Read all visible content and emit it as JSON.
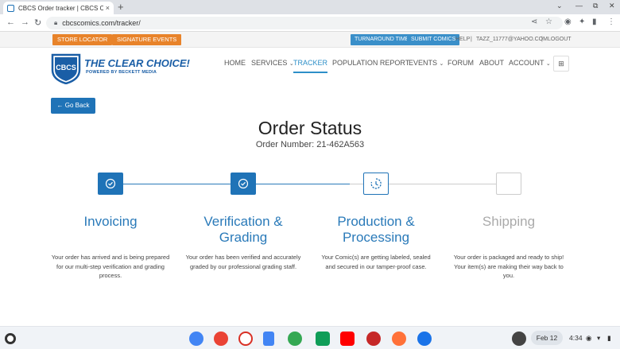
{
  "browser": {
    "tab_title": "CBCS Order tracker | CBCS Comi",
    "tab_close": "×",
    "new_tab": "+",
    "url": "cbcscomics.com/tracker/",
    "back": "←",
    "forward": "→",
    "reload": "↻",
    "minimize": "—",
    "restore": "⧉",
    "close": "✕",
    "dropdown": "⌄"
  },
  "utility": {
    "store_locator": "STORE LOCATOR",
    "signature_events": "SIGNATURE EVENTS",
    "turnaround_times": "TURNAROUND TIMES",
    "submit_comics": "SUBMIT COMICS",
    "help": "HELP",
    "user_email": "TAZZ_11777@YAHOO.COM",
    "logout": "LOGOUT",
    "separator": "|"
  },
  "logo": {
    "mark": "CBCS",
    "tagline": "THE CLEAR CHOICE!",
    "powered": "POWERED BY BECKETT MEDIA"
  },
  "nav": {
    "home": "HOME",
    "services": "SERVICES",
    "tracker": "TRACKER",
    "population": "POPULATION REPORT",
    "events": "EVENTS",
    "forum": "FORUM",
    "about": "ABOUT",
    "account": "ACCOUNT",
    "caret": "⌄",
    "cart_icon": "🛒"
  },
  "page": {
    "back_button": "← Go Back",
    "title": "Order Status",
    "order_number": "Order Number: 21-462A563"
  },
  "steps": [
    {
      "title": "Invoicing",
      "status": "done",
      "desc": "Your order has arrived and is being prepared for our multi-step verification and grading process."
    },
    {
      "title": "Verification & Grading",
      "status": "done",
      "desc": "Your order has been verified and accurately graded by our professional grading staff."
    },
    {
      "title": "Production & Processing",
      "status": "current",
      "desc": "Your Comic(s) are getting labeled, sealed and secured in our tamper-proof case."
    },
    {
      "title": "Shipping",
      "status": "pending",
      "desc": "Your order is packaged and ready to ship! Your item(s) are making their way back to you."
    }
  ],
  "progress_fraction": 0.6,
  "colors": {
    "accent": "#1f73b7",
    "orange": "#e8832a",
    "step_title": "#2a7ab9",
    "pending": "#aaaaaa"
  },
  "shelf": {
    "date": "Feb 12",
    "time": "4:34",
    "apps": [
      "files-icon",
      "chrome-icon",
      "gmail-icon",
      "docs-icon",
      "play-store-icon",
      "sheets-icon",
      "youtube-icon",
      "app-icon",
      "firefox-icon",
      "camera-icon"
    ]
  }
}
